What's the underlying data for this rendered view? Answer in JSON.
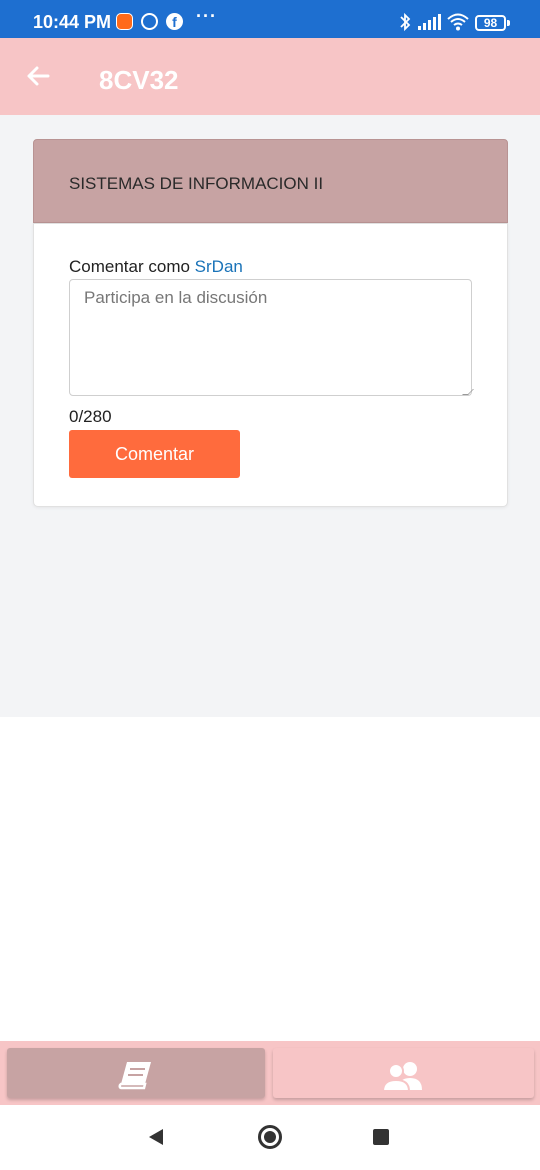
{
  "status_bar": {
    "time": "10:44 PM",
    "battery": "98",
    "icons": [
      "mi-icon",
      "ring-icon",
      "facebook-icon",
      "more-dots-icon",
      "bluetooth-icon",
      "signal-icon",
      "wifi-icon",
      "battery-icon"
    ]
  },
  "app_bar": {
    "title": "8CV32",
    "back_icon": "arrow-left-icon"
  },
  "course": {
    "title": "SISTEMAS DE INFORMACION II"
  },
  "comment_form": {
    "label_prefix": "Comentar como",
    "username": "SrDan",
    "placeholder": "Participa en la discusión",
    "value": "",
    "char_counter": "0/280",
    "submit_label": "Comentar"
  },
  "bottom_tabs": [
    {
      "icon": "book-icon",
      "active": true
    },
    {
      "icon": "users-icon",
      "active": false
    }
  ],
  "nav_bar": {
    "icons": [
      "nav-back-icon",
      "nav-home-icon",
      "nav-recents-icon"
    ]
  },
  "colors": {
    "status_bar": "#1e6fd0",
    "app_bar": "#f7c5c6",
    "course_header": "#c7a3a3",
    "accent_button": "#ff6b3d",
    "username_link": "#1a73b8",
    "content_bg": "#f3f4f6"
  }
}
